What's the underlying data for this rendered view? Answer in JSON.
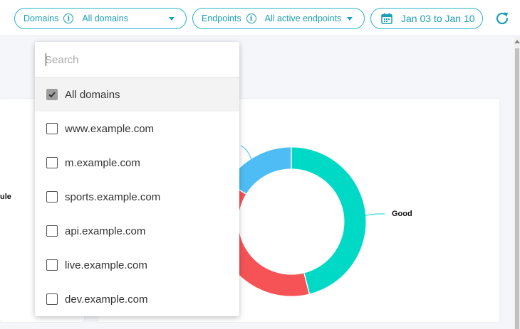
{
  "filters": {
    "domains": {
      "label": "Domains",
      "value": "All domains"
    },
    "endpoints": {
      "label": "Endpoints",
      "value": "All active endpoints"
    },
    "date_range": "Jan 03 to Jan 10"
  },
  "dropdown": {
    "search_placeholder": "Search",
    "items": [
      {
        "label": "All domains",
        "checked": true
      },
      {
        "label": "www.example.com",
        "checked": false
      },
      {
        "label": "m.example.com",
        "checked": false
      },
      {
        "label": "sports.example.com",
        "checked": false
      },
      {
        "label": "api.example.com",
        "checked": false
      },
      {
        "label": "live.example.com",
        "checked": false
      },
      {
        "label": "dev.example.com",
        "checked": false
      }
    ]
  },
  "left_chart": {
    "partial_label": "ule"
  },
  "right_chart": {
    "type": "donut",
    "good_label": "Good",
    "colors": {
      "good": "#00d9c6",
      "bad": "#f55356",
      "other": "#4ebdf5"
    }
  },
  "colors": {
    "accent": "#1a9fb3",
    "border": "#29b6c8"
  }
}
